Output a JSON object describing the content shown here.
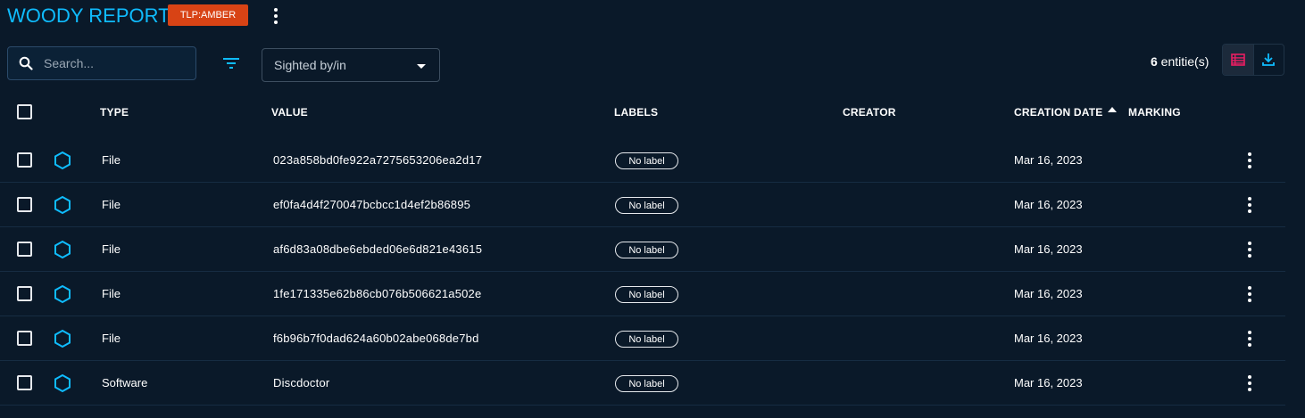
{
  "header": {
    "title": "WOODY REPORT",
    "marking": "TLP:AMBER",
    "marking_color": "#d84315"
  },
  "toolbar": {
    "search_placeholder": "Search...",
    "filter_icon": "filter-icon",
    "sighted_select": "Sighted by/in",
    "count_number": "6",
    "count_suffix": " entitie(s)",
    "view_lines_icon": "list-view-icon",
    "export_icon": "download-icon"
  },
  "table": {
    "columns": {
      "type": "TYPE",
      "value": "VALUE",
      "labels": "LABELS",
      "creator": "CREATOR",
      "creation_date": "CREATION DATE",
      "marking": "MARKING"
    },
    "sort": {
      "column": "creation_date",
      "direction": "asc"
    },
    "rows": [
      {
        "type": "File",
        "value": "023a858bd0fe922a7275653206ea2d17",
        "label": "No label",
        "creator": "",
        "date": "Mar 16, 2023",
        "icon": "hexagon-icon"
      },
      {
        "type": "File",
        "value": "ef0fa4d4f270047bcbcc1d4ef2b86895",
        "label": "No label",
        "creator": "",
        "date": "Mar 16, 2023",
        "icon": "hexagon-icon"
      },
      {
        "type": "File",
        "value": "af6d83a08dbe6ebded06e6d821e43615",
        "label": "No label",
        "creator": "",
        "date": "Mar 16, 2023",
        "icon": "hexagon-icon"
      },
      {
        "type": "File",
        "value": "1fe171335e62b86cb076b506621a502e",
        "label": "No label",
        "creator": "",
        "date": "Mar 16, 2023",
        "icon": "hexagon-icon"
      },
      {
        "type": "File",
        "value": "f6b96b7f0dad624a60b02abe068de7bd",
        "label": "No label",
        "creator": "",
        "date": "Mar 16, 2023",
        "icon": "hexagon-icon"
      },
      {
        "type": "Software",
        "value": "Discdoctor",
        "label": "No label",
        "creator": "",
        "date": "Mar 16, 2023",
        "icon": "hexagon-icon"
      }
    ]
  },
  "colors": {
    "background": "#0a1929",
    "accent": "#0fbcff",
    "list_view_active": "#e91e63"
  }
}
